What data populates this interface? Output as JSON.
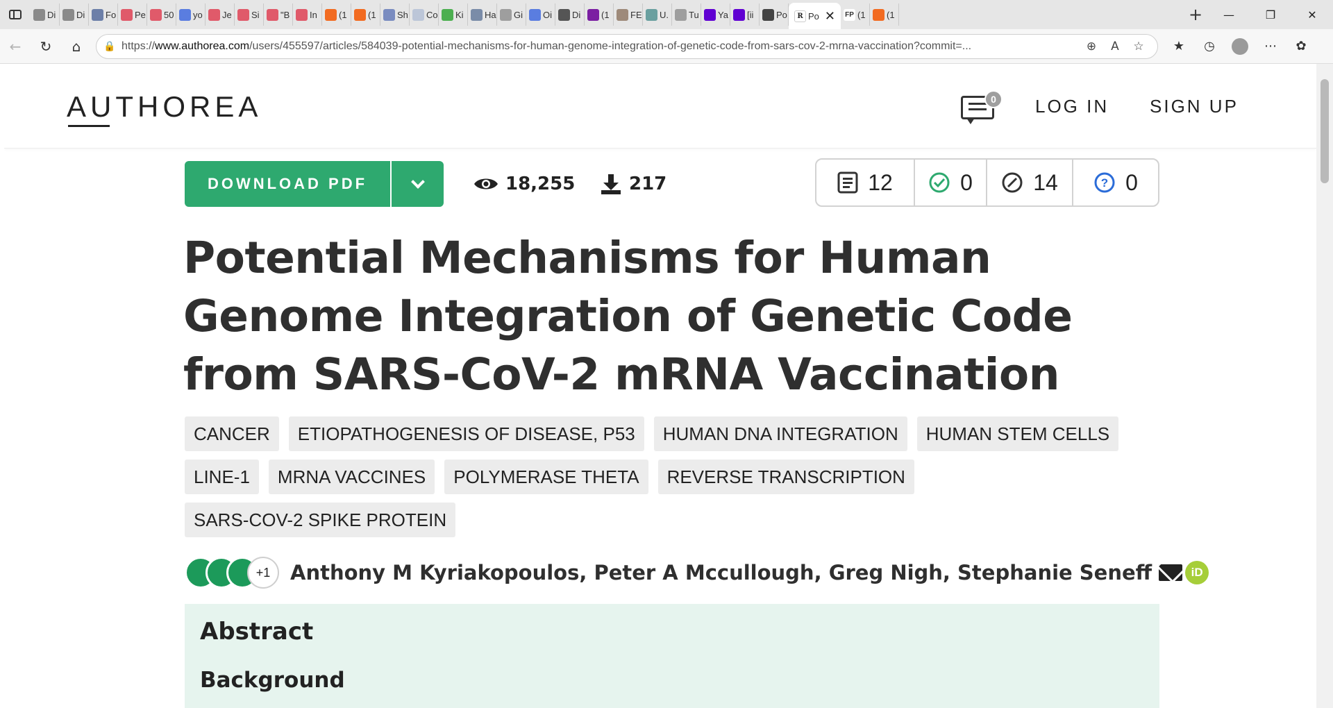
{
  "browser": {
    "tabs": [
      {
        "label": "Di",
        "color": "#8a8a8a"
      },
      {
        "label": "Di",
        "color": "#8a8a8a"
      },
      {
        "label": "Fo",
        "color": "#6c7fa8"
      },
      {
        "label": "Pe",
        "color": "#e05a6a"
      },
      {
        "label": "50",
        "color": "#e05a6a"
      },
      {
        "label": "yo",
        "color": "#5a7de0"
      },
      {
        "label": "Je",
        "color": "#e05a6a"
      },
      {
        "label": "Si",
        "color": "#e05a6a"
      },
      {
        "label": "\"B",
        "color": "#e05a6a"
      },
      {
        "label": "In",
        "color": "#e05a6a"
      },
      {
        "label": "(1",
        "color": "#f26b21"
      },
      {
        "label": "(1",
        "color": "#f26b21"
      },
      {
        "label": "Sh",
        "color": "#7a8cc0"
      },
      {
        "label": "Co",
        "color": "#bcc6d8"
      },
      {
        "label": "Ki",
        "color": "#4caf50"
      },
      {
        "label": "Ha",
        "color": "#7a8ca8"
      },
      {
        "label": "Gi",
        "color": "#9e9e9e"
      },
      {
        "label": "Oi",
        "color": "#5a7de0"
      },
      {
        "label": "Di",
        "color": "#555555"
      },
      {
        "label": "(1",
        "color": "#7b1fa2"
      },
      {
        "label": "FE",
        "color": "#9e8a7a"
      },
      {
        "label": "U.",
        "color": "#6aa0a0"
      },
      {
        "label": "Tu",
        "color": "#9e9e9e"
      },
      {
        "label": "Ya",
        "color": "#6001d2"
      },
      {
        "label": "[ii",
        "color": "#6001d2"
      },
      {
        "label": "Po",
        "color": "#444444"
      }
    ],
    "active_tab": {
      "label": "Po",
      "favicon": "R"
    },
    "after_tabs": [
      {
        "label": "(1",
        "color": "#333333",
        "favicon": "FP"
      },
      {
        "label": "(1",
        "color": "#f26b21",
        "favicon": ""
      }
    ],
    "new_tab": "+",
    "url_prefix": "https://",
    "url_host": "www.authorea.com",
    "url_path": "/users/455597/articles/584039-potential-mechanisms-for-human-genome-integration-of-genetic-code-from-sars-cov-2-mrna-vaccination?commit=..."
  },
  "header": {
    "logo": "AUTHOREA",
    "comments_count": "0",
    "login": "LOG IN",
    "signup": "SIGN UP"
  },
  "actions": {
    "download_pdf": "DOWNLOAD PDF",
    "views": "18,255",
    "downloads": "217"
  },
  "review": {
    "notes": "12",
    "endorsements": "0",
    "edits": "14",
    "questions": "0",
    "colors": {
      "check": "#2ea96f",
      "question": "#2b6cd8"
    }
  },
  "article": {
    "title": "Potential Mechanisms for Human Genome Integration of Genetic Code from SARS-CoV-2 mRNA Vaccination",
    "keywords": [
      "CANCER",
      "ETIOPATHOGENESIS OF DISEASE, P53",
      "HUMAN DNA INTEGRATION",
      "HUMAN STEM CELLS",
      "LINE-1",
      "MRNA VACCINES",
      "POLYMERASE THETA",
      "REVERSE TRANSCRIPTION",
      "SARS-COV-2 SPIKE PROTEIN"
    ],
    "authors_more": "+1",
    "authors": "Anthony M Kyriakopoulos, Peter A Mccullough, Greg Nigh, Stephanie Seneff",
    "orcid": "iD",
    "abstract_heading": "Abstract",
    "background_heading": "Background"
  },
  "icons": {
    "sidebar": "sidebar-toggle-icon",
    "views": "eye-icon",
    "downloads": "download-icon",
    "notes": "document-icon",
    "endorsements": "check-circle-icon",
    "edits": "pencil-circle-icon",
    "questions": "question-circle-icon",
    "email": "envelope-icon",
    "orcid": "orcid-icon"
  },
  "colors": {
    "brand_green": "#2ea96f",
    "author_green": "#1c9a5a",
    "abstract_bg": "#e6f4ee"
  }
}
